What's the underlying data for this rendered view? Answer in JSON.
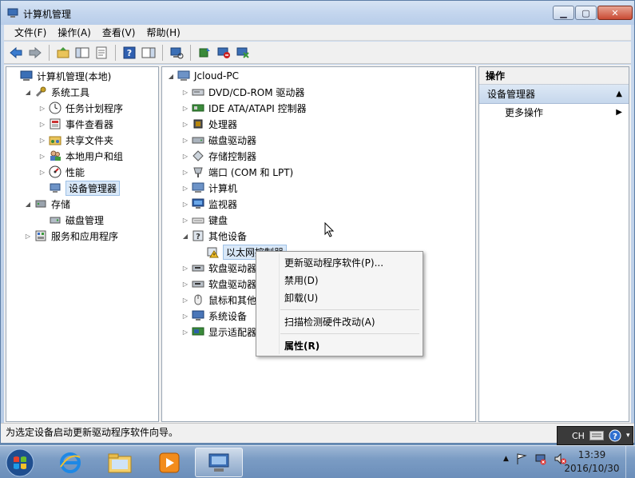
{
  "window": {
    "title": "计算机管理"
  },
  "menu": [
    "文件(F)",
    "操作(A)",
    "查看(V)",
    "帮助(H)"
  ],
  "toolbar_icons": [
    "back-arrow-icon",
    "forward-arrow-icon",
    "up-folder-icon",
    "show-tree-icon",
    "properties-icon",
    "help-icon",
    "show-action-icon",
    "scan-hardware-icon",
    "update-driver-icon",
    "disable-device-icon",
    "uninstall-device-icon"
  ],
  "left_tree": [
    {
      "label": "计算机管理(本地)",
      "icon": "computer-management-icon",
      "level": 0,
      "expander": ""
    },
    {
      "label": "系统工具",
      "icon": "system-tools-icon",
      "level": 1,
      "expander": "▲"
    },
    {
      "label": "任务计划程序",
      "icon": "clock-icon",
      "level": 2,
      "expander": "▷"
    },
    {
      "label": "事件查看器",
      "icon": "event-viewer-icon",
      "level": 2,
      "expander": "▷"
    },
    {
      "label": "共享文件夹",
      "icon": "shared-folder-icon",
      "level": 2,
      "expander": "▷"
    },
    {
      "label": "本地用户和组",
      "icon": "users-icon",
      "level": 2,
      "expander": "▷"
    },
    {
      "label": "性能",
      "icon": "performance-icon",
      "level": 2,
      "expander": "▷"
    },
    {
      "label": "设备管理器",
      "icon": "device-manager-icon",
      "level": 2,
      "expander": "",
      "selected": true
    },
    {
      "label": "存储",
      "icon": "storage-icon",
      "level": 1,
      "expander": "▲"
    },
    {
      "label": "磁盘管理",
      "icon": "disk-management-icon",
      "level": 2,
      "expander": ""
    },
    {
      "label": "服务和应用程序",
      "icon": "services-icon",
      "level": 1,
      "expander": "▷"
    }
  ],
  "device_tree": {
    "root": "Jcloud-PC",
    "items": [
      {
        "label": "DVD/CD-ROM 驱动器",
        "icon": "dvd-drive-icon",
        "expander": "▷"
      },
      {
        "label": "IDE ATA/ATAPI 控制器",
        "icon": "ide-controller-icon",
        "expander": "▷"
      },
      {
        "label": "处理器",
        "icon": "processor-icon",
        "expander": "▷"
      },
      {
        "label": "磁盘驱动器",
        "icon": "disk-drive-icon",
        "expander": "▷"
      },
      {
        "label": "存储控制器",
        "icon": "storage-controller-icon",
        "expander": "▷"
      },
      {
        "label": "端口 (COM 和 LPT)",
        "icon": "port-icon",
        "expander": "▷"
      },
      {
        "label": "计算机",
        "icon": "computer-icon",
        "expander": "▷"
      },
      {
        "label": "监视器",
        "icon": "monitor-icon",
        "expander": "▷"
      },
      {
        "label": "键盘",
        "icon": "keyboard-icon",
        "expander": "▷"
      },
      {
        "label": "其他设备",
        "icon": "other-devices-icon",
        "expander": "▲"
      },
      {
        "label": "以太网控制器",
        "icon": "warning-device-icon",
        "expander": "",
        "child": true,
        "selected": true
      },
      {
        "label": "软盘驱动器",
        "icon": "floppy-drive-icon",
        "expander": "▷"
      },
      {
        "label": "软盘驱动器",
        "icon": "floppy-controller-icon",
        "expander": "▷"
      },
      {
        "label": "鼠标和其他",
        "icon": "mouse-icon",
        "expander": "▷"
      },
      {
        "label": "系统设备",
        "icon": "system-devices-icon",
        "expander": "▷"
      },
      {
        "label": "显示适配器",
        "icon": "display-adapter-icon",
        "expander": "▷"
      }
    ]
  },
  "actions": {
    "header": "操作",
    "group": "设备管理器",
    "more": "更多操作"
  },
  "context_menu": [
    {
      "label": "更新驱动程序软件(P)...",
      "bold": false
    },
    {
      "label": "禁用(D)",
      "bold": false
    },
    {
      "label": "卸载(U)",
      "bold": false
    },
    {
      "sep": true
    },
    {
      "label": "扫描检测硬件改动(A)",
      "bold": false
    },
    {
      "sep": true
    },
    {
      "label": "属性(R)",
      "bold": true
    }
  ],
  "status": "为选定设备启动更新驱动程序软件向导。",
  "ime": {
    "lang": "CH"
  },
  "taskbar": {
    "apps": [
      "internet-explorer-icon",
      "file-explorer-icon",
      "media-player-icon",
      "computer-management-icon"
    ],
    "time": "13:39",
    "date": "2016/10/30"
  },
  "colors": {
    "selection": "#d9e8f8",
    "action_group": "#c6d7ec",
    "close_button": "#c94a33"
  }
}
